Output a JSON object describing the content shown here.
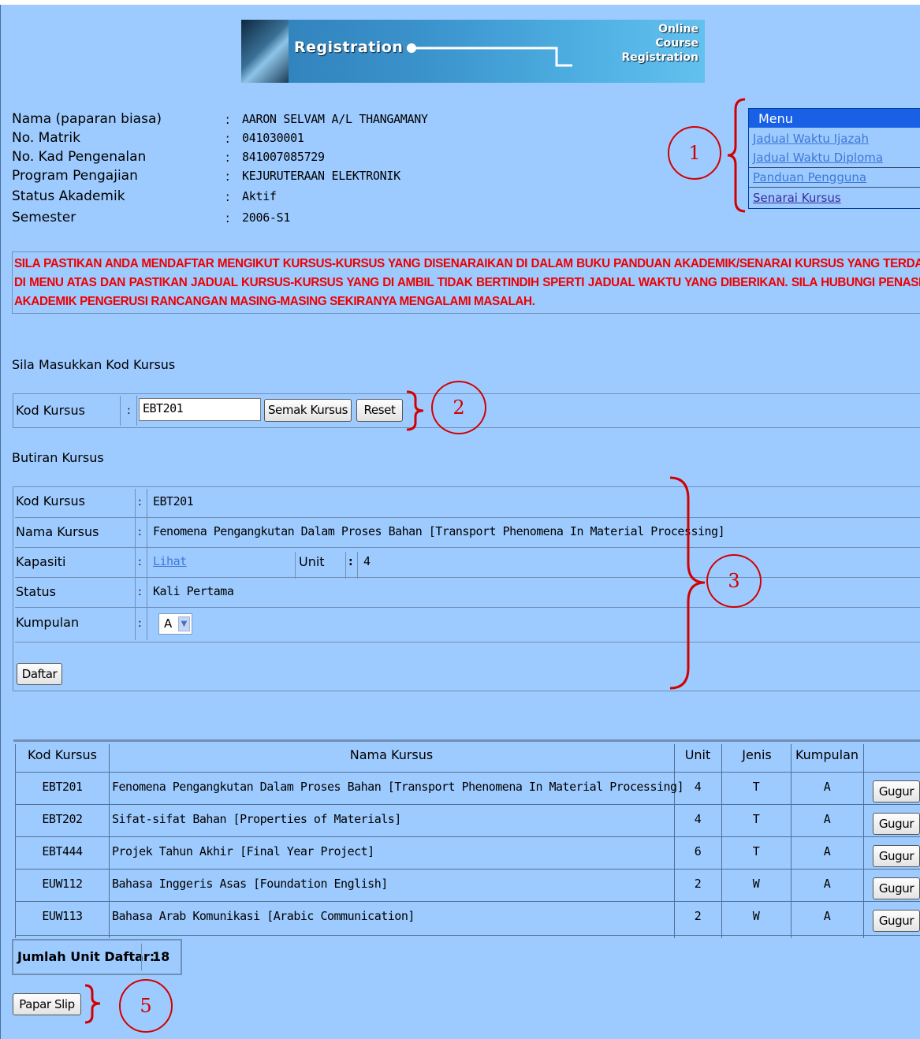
{
  "banner": {
    "title": "Registration",
    "line1": "Online",
    "line2": "Course",
    "line3": "Registration"
  },
  "student": {
    "rows": [
      {
        "label": "Nama (paparan biasa)",
        "value": "AARON SELVAM A/L THANGAMANY"
      },
      {
        "label": "No. Matrik",
        "value": "041030001"
      },
      {
        "label": "No. Kad Pengenalan",
        "value": "841007085729"
      },
      {
        "label": "Program Pengajian",
        "value": "KEJURUTERAAN ELEKTRONIK"
      },
      {
        "label": "Status Akademik",
        "value": "Aktif"
      },
      {
        "label": "Semester",
        "value": "2006-S1"
      }
    ],
    "colon": ":"
  },
  "menu": {
    "title": "Menu",
    "items": [
      "Jadual Waktu Ijazah",
      "Jadual Waktu Diploma",
      "Panduan Pengguna",
      "Senarai Kursus"
    ]
  },
  "annotations": [
    "1",
    "2",
    "3",
    "5"
  ],
  "notice": "SILA PASTIKAN ANDA MENDAFTAR MENGIKUT KURSUS-KURSUS YANG DISENARAIKAN DI DALAM BUKU PANDUAN AKADEMIK/SENARAI KURSUS YANG TERDAPAT DI MENU ATAS DAN PASTIKAN JADUAL KURSUS-KURSUS YANG DI AMBIL TIDAK BERTINDIH SPERTI JADUAL WAKTU YANG DIBERIKAN. SILA HUBUNGI PENASIHAT AKADEMIK PENGERUSI RANCANGAN MASING-MASING SEKIRANYA MENGALAMI MASALAH.",
  "entry": {
    "heading": "Sila Masukkan Kod Kursus",
    "label": "Kod Kursus",
    "colon": ":",
    "value": "EBT201",
    "check_button": "Semak Kursus",
    "reset_button": "Reset"
  },
  "details": {
    "heading": "Butiran Kursus",
    "kod_label": "Kod Kursus",
    "kod_value": "EBT201",
    "nama_label": "Nama Kursus",
    "nama_value": "Fenomena Pengangkutan Dalam Proses Bahan [Transport Phenomena In Material Processing]",
    "kapasiti_label": "Kapasiti",
    "kapasiti_link": "Lihat",
    "unit_label": "Unit",
    "unit_value": "4",
    "status_label": "Status",
    "status_value": "Kali Pertama",
    "kumpulan_label": "Kumpulan",
    "kumpulan_value": "A",
    "daftar_button": "Daftar",
    "colon": ":"
  },
  "courses": {
    "headers": [
      "Kod Kursus",
      "Nama Kursus",
      "Unit",
      "Jenis",
      "Kumpulan"
    ],
    "rows": [
      {
        "kod": "EBT201",
        "nama": "Fenomena Pengangkutan Dalam Proses Bahan [Transport Phenomena In Material Processing]",
        "unit": "4",
        "jenis": "T",
        "kumpulan": "A",
        "action": "Gugur"
      },
      {
        "kod": "EBT202",
        "nama": "Sifat-sifat Bahan [Properties of Materials]",
        "unit": "4",
        "jenis": "T",
        "kumpulan": "A",
        "action": "Gugur"
      },
      {
        "kod": "EBT444",
        "nama": "Projek Tahun Akhir [Final Year Project]",
        "unit": "6",
        "jenis": "T",
        "kumpulan": "A",
        "action": "Gugur"
      },
      {
        "kod": "EUW112",
        "nama": "Bahasa Inggeris Asas [Foundation English]",
        "unit": "2",
        "jenis": "W",
        "kumpulan": "A",
        "action": "Gugur"
      },
      {
        "kod": "EUW113",
        "nama": "Bahasa Arab Komunikasi [Arabic Communication]",
        "unit": "2",
        "jenis": "W",
        "kumpulan": "A",
        "action": "Gugur"
      }
    ]
  },
  "total": {
    "label": "Jumlah Unit Daftar:",
    "value": "18"
  },
  "slip_button": "Papar Slip",
  "colors": {
    "background": "#9ecbff",
    "menu_header": "#1861e6",
    "notice": "#e00000",
    "annotation": "#d20000",
    "link": "#1a5fd1"
  }
}
